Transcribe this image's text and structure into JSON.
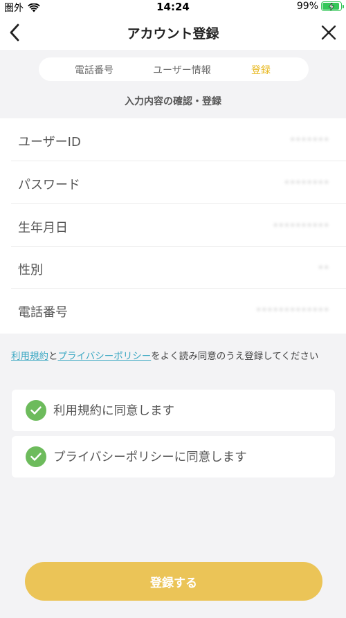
{
  "status_bar": {
    "carrier": "圏外",
    "time": "14:24",
    "battery": "99%"
  },
  "nav": {
    "title": "アカウント登録",
    "back_icon": "chevron-left-icon",
    "close_icon": "close-icon"
  },
  "steps": [
    {
      "label": "電話番号",
      "active": false
    },
    {
      "label": "ユーザー情報",
      "active": false
    },
    {
      "label": "登録",
      "active": true
    }
  ],
  "section_heading": "入力内容の確認・登録",
  "info_rows": [
    {
      "label": "ユーザーID",
      "value": "•••••••"
    },
    {
      "label": "パスワード",
      "value": "••••••••"
    },
    {
      "label": "生年月日",
      "value": "••••••••••"
    },
    {
      "label": "性別",
      "value": "••"
    },
    {
      "label": "電話番号",
      "value": "•••••••••••••"
    }
  ],
  "agreement": {
    "terms_link": "利用規約",
    "conj": "と",
    "privacy_link": "プライバシーポリシー",
    "rest": "をよく読み同意のうえ登録してください"
  },
  "checkboxes": [
    {
      "label": "利用規約に同意します",
      "checked": true
    },
    {
      "label": "プライバシーポリシーに同意します",
      "checked": true
    }
  ],
  "submit_label": "登録する",
  "colors": {
    "accent": "#ebc457",
    "step_active": "#e8b820",
    "link": "#3aa7c2",
    "check": "#6dbb5c",
    "battery": "#34c759"
  }
}
